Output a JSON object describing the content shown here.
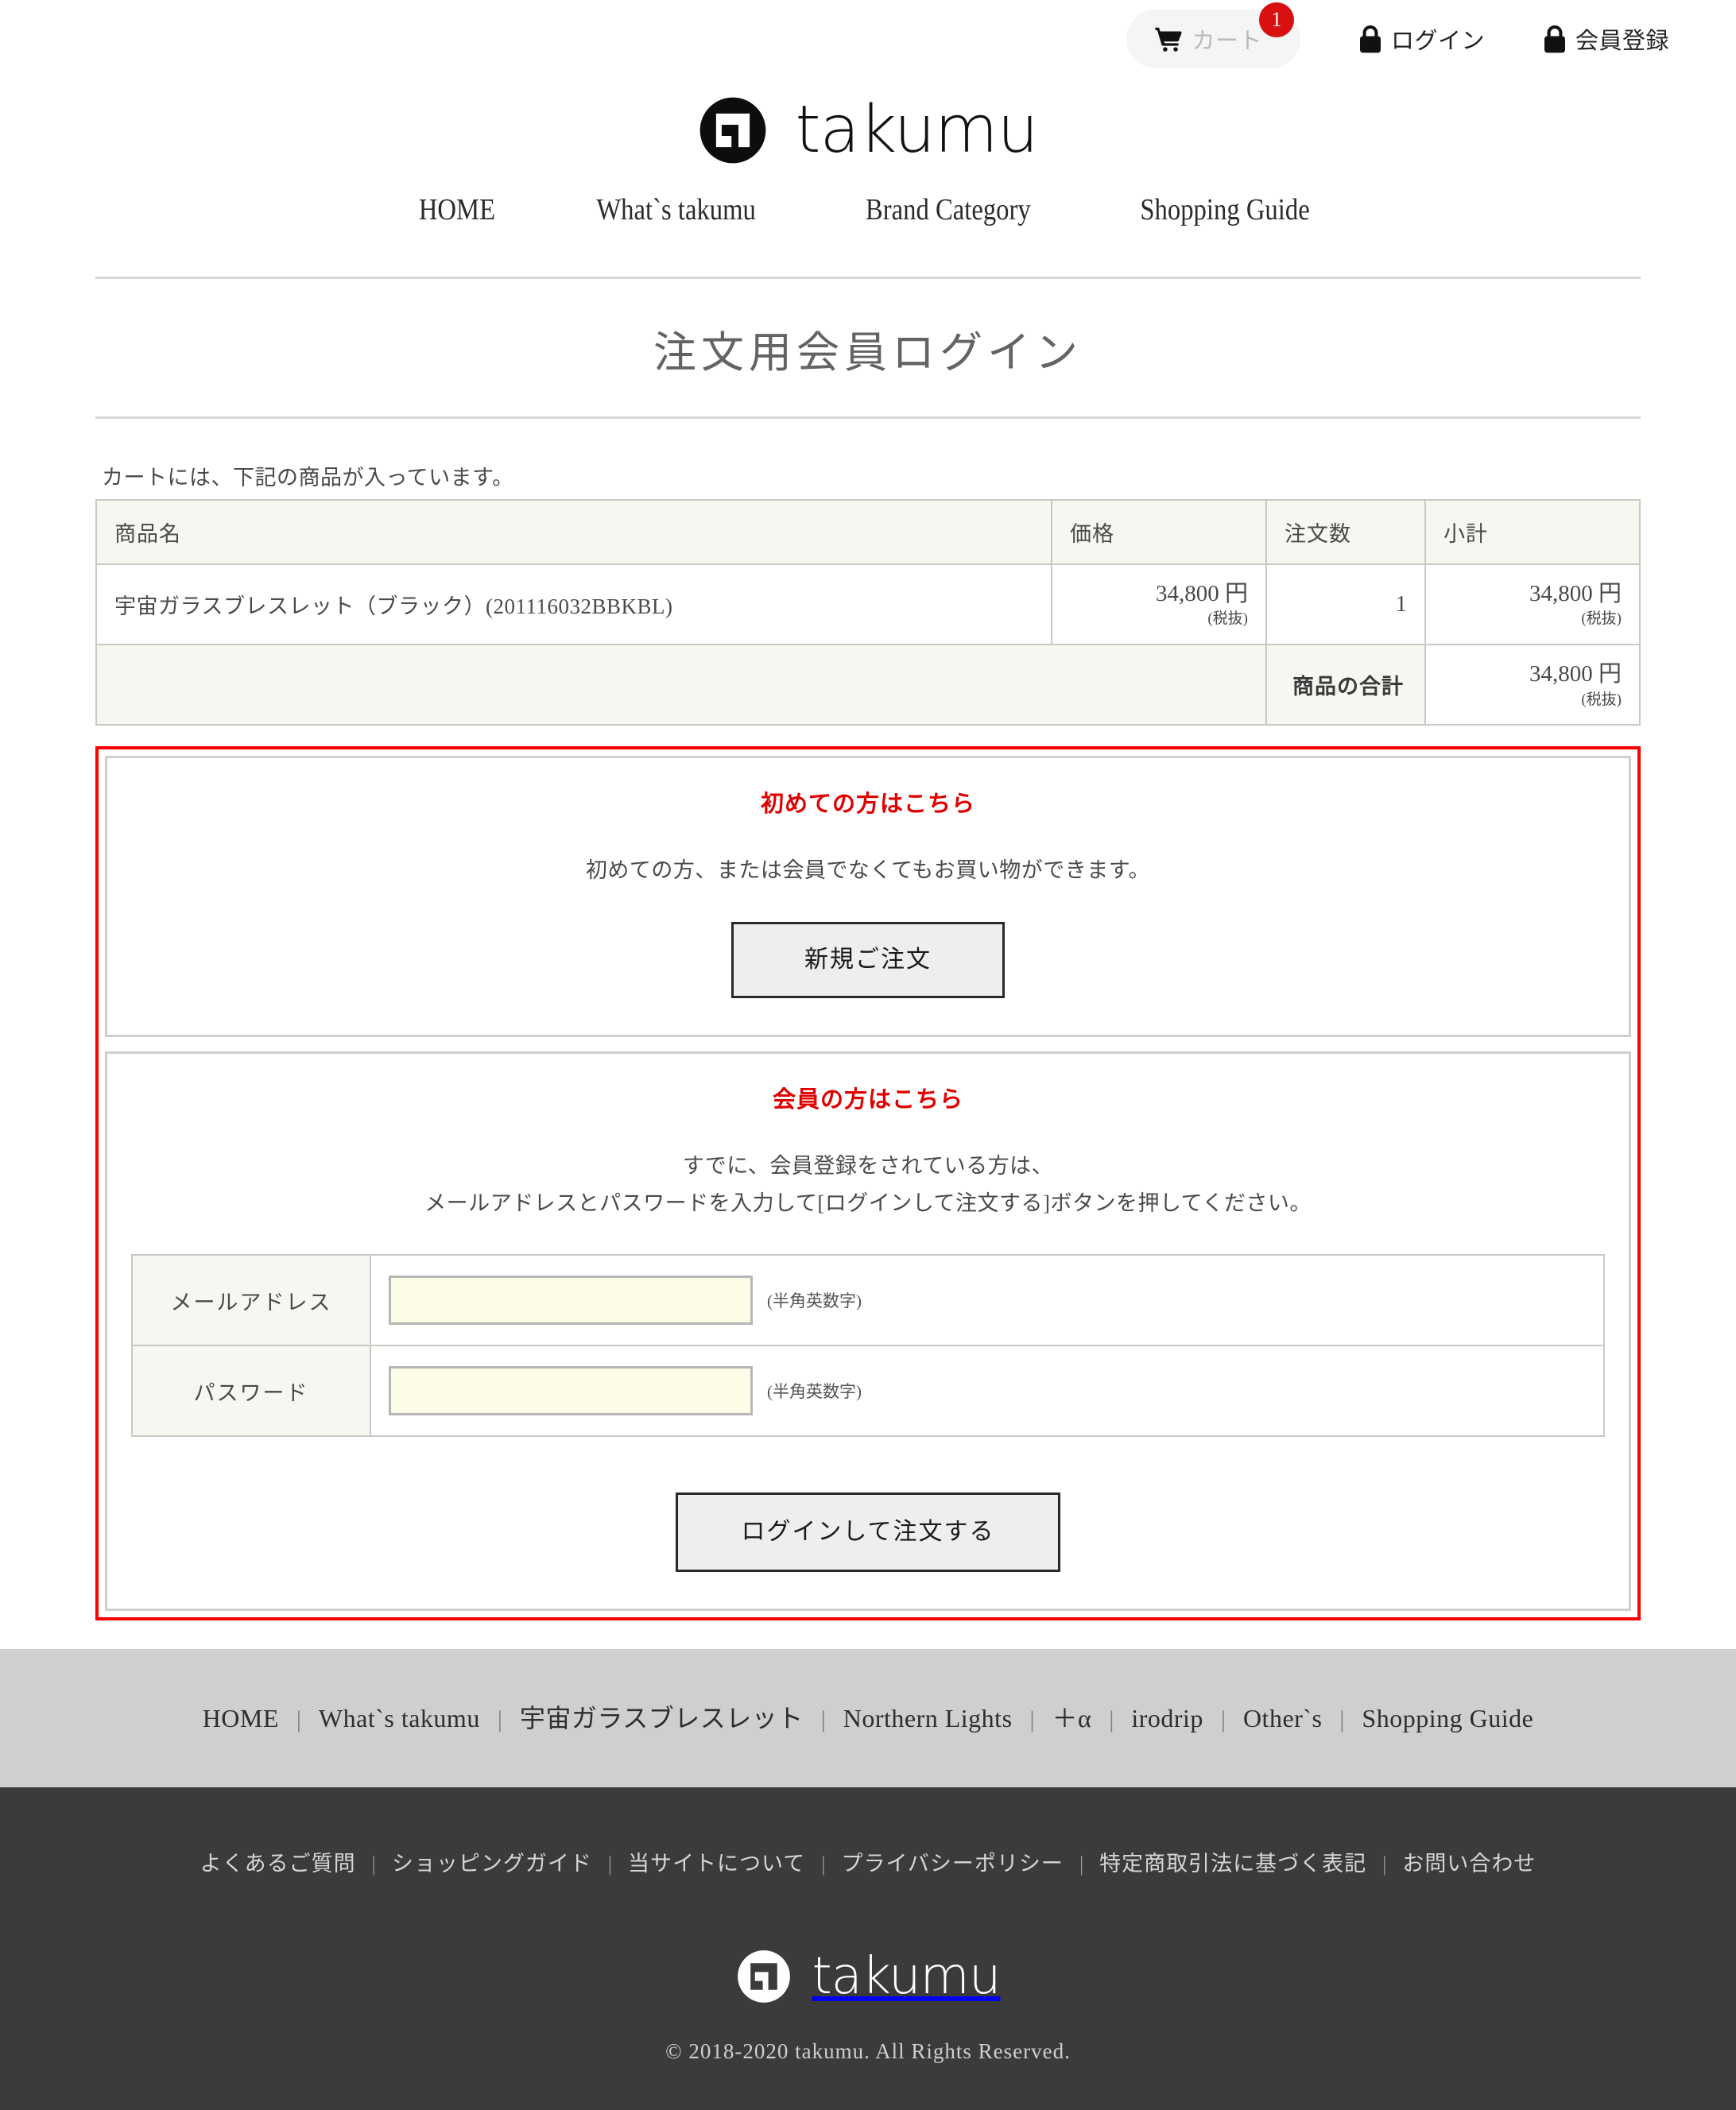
{
  "topbar": {
    "cart": {
      "label": "カート",
      "badge": "1",
      "icon": "cart-icon"
    },
    "login": {
      "label": "ログイン",
      "icon": "lock-icon"
    },
    "register": {
      "label": "会員登録",
      "icon": "lock-icon"
    }
  },
  "brand": {
    "name": "takumu",
    "logo_icon": "takumu-spiral-logo"
  },
  "mainnav": [
    {
      "label": "HOME"
    },
    {
      "label": "What`s takumu"
    },
    {
      "label": "Brand Category"
    },
    {
      "label": "Shopping Guide"
    }
  ],
  "page": {
    "title": "注文用会員ログイン"
  },
  "cart": {
    "notice": "カートには、下記の商品が入っています。",
    "headers": [
      "商品名",
      "価格",
      "注文数",
      "小計"
    ],
    "rows": [
      {
        "name": "宇宙ガラスブレスレット（ブラック）(201116032BBKBL)",
        "price": "34,800 円",
        "price_tax": "(税抜)",
        "qty": "1",
        "subtotal": "34,800 円",
        "subtotal_tax": "(税抜)"
      }
    ],
    "total_label": "商品の合計",
    "total_value": "34,800 円",
    "total_tax": "(税抜)"
  },
  "guest_panel": {
    "heading": "初めての方はこちら",
    "description": "初めての方、または会員でなくてもお買い物ができます。",
    "button_label": "新規ご注文"
  },
  "member_panel": {
    "heading": "会員の方はこちら",
    "description_line1": "すでに、会員登録をされている方は、",
    "description_line2": "メールアドレスとパスワードを入力して[ログインして注文する]ボタンを押してください。",
    "fields": [
      {
        "label": "メールアドレス",
        "value": "",
        "placeholder": "",
        "hint": "(半角英数字)"
      },
      {
        "label": "パスワード",
        "value": "",
        "placeholder": "",
        "hint": "(半角英数字)"
      }
    ],
    "button_label": "ログインして注文する"
  },
  "footer_nav": [
    {
      "label": "HOME"
    },
    {
      "label": "What`s takumu"
    },
    {
      "label": "宇宙ガラスブレスレット"
    },
    {
      "label": "Northern Lights"
    },
    {
      "label": "＋α"
    },
    {
      "label": "irodrip"
    },
    {
      "label": "Other`s"
    },
    {
      "label": "Shopping Guide"
    }
  ],
  "footer_links": [
    {
      "label": "よくあるご質問"
    },
    {
      "label": "ショッピングガイド"
    },
    {
      "label": "当サイトについて"
    },
    {
      "label": "プライバシーポリシー"
    },
    {
      "label": "特定商取引法に基づく表記"
    },
    {
      "label": "お問い合わせ"
    }
  ],
  "footer": {
    "copyright": "© 2018-2020 takumu. All Rights Reserved.",
    "separator": "|"
  },
  "colors": {
    "accent_red": "#ff0000",
    "badge_red": "#d81010",
    "table_header_bg": "#f7f6f1",
    "input_bg": "#fdfce6",
    "footer_nav_bg": "#cfcfcf",
    "footer_bg": "#3b3b3b"
  }
}
